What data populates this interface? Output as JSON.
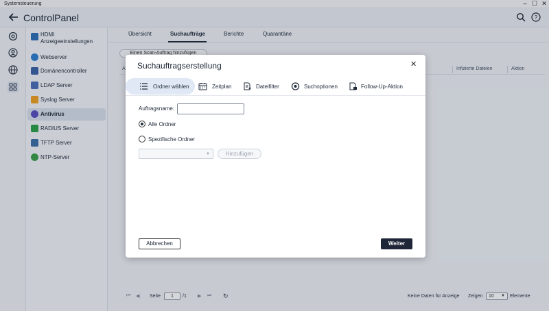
{
  "window": {
    "title": "Systemsteuerung"
  },
  "app": {
    "title": "ControlPanel"
  },
  "sidebar": {
    "items": [
      {
        "label": "HDMI Anzeigeeinstellungen",
        "icon": "monitor-icon",
        "color": "#2f6fb7"
      },
      {
        "label": "Webserver",
        "icon": "globe-icon",
        "color": "#2d7fd0"
      },
      {
        "label": "Domänencontroller",
        "icon": "domain-controller-icon",
        "color": "#3a62a8"
      },
      {
        "label": "LDAP Server",
        "icon": "ldap-icon",
        "color": "#4c6fb8"
      },
      {
        "label": "Syslog Server",
        "icon": "mail-icon",
        "color": "#f0a020"
      },
      {
        "label": "Antivirus",
        "icon": "antivirus-icon",
        "color": "#5a4fc0",
        "active": true
      },
      {
        "label": "RADIUS Server",
        "icon": "radius-icon",
        "color": "#2aa14a"
      },
      {
        "label": "TFTP Server",
        "icon": "tftp-icon",
        "color": "#3a6fa8"
      },
      {
        "label": "NTP-Server",
        "icon": "ntp-icon",
        "color": "#3aa04a"
      }
    ]
  },
  "tabs": [
    {
      "label": "Übersicht"
    },
    {
      "label": "Suchaufträge",
      "active": true
    },
    {
      "label": "Berichte"
    },
    {
      "label": "Quarantäne"
    }
  ],
  "main": {
    "add_scan_button": "Einen Scan-Auftrag hinzufügen",
    "col_first": "A",
    "col_infected": "Infizierte Dateien",
    "col_action": "Aktion"
  },
  "pager": {
    "page_label": "Seite",
    "page_value": "1",
    "page_total": "/1",
    "no_data": "Keine Daten für Anzeige",
    "show_label": "Zeigen",
    "page_size": "10",
    "items_label": "Elemente"
  },
  "modal": {
    "title": "Suchauftragserstellung",
    "steps": [
      {
        "label": "Ordner wählen",
        "icon": "list-icon",
        "active": true
      },
      {
        "label": "Zeitplan",
        "icon": "calendar-icon"
      },
      {
        "label": "Dateifilter",
        "icon": "file-filter-icon"
      },
      {
        "label": "Suchoptionen",
        "icon": "scan-options-icon"
      },
      {
        "label": "Follow-Up-Aktion",
        "icon": "follow-up-icon"
      }
    ],
    "job_name_label": "Auftragsname:",
    "job_name_value": "",
    "radio_all": "Alle Ordner",
    "radio_specific": "Spezifische Ordner",
    "selected_option": "all",
    "folder_select_value": "",
    "add_button": "Hinzufügen",
    "cancel_button": "Abbrechen",
    "next_button": "Weiter"
  },
  "colors": {
    "accent": "#1f2638",
    "active_bg": "#d7e0ec",
    "step_active_bg": "#dfe8f4"
  }
}
